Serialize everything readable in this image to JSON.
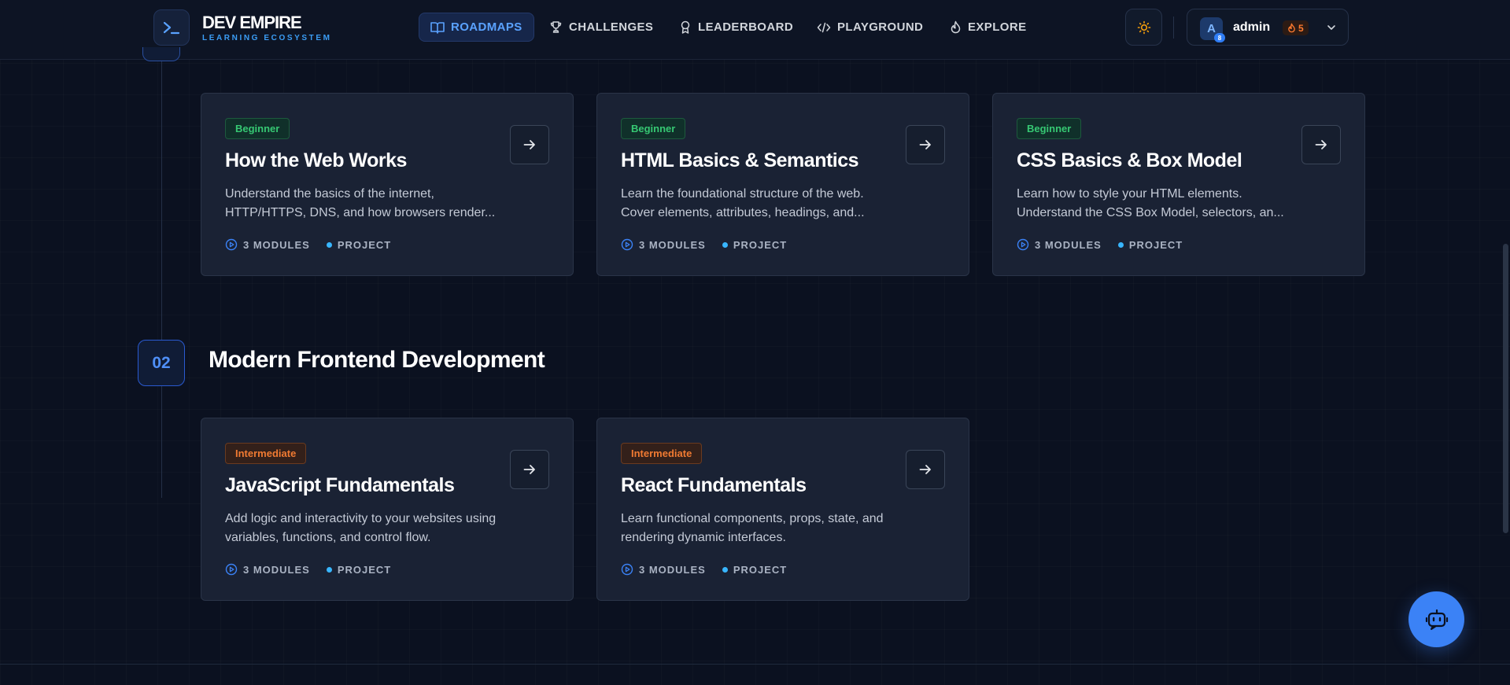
{
  "brand": {
    "title": "DEV EMPIRE",
    "subtitle": "LEARNING ECOSYSTEM",
    "accent": "#3b82f6"
  },
  "nav": [
    {
      "label": "ROADMAPS",
      "icon": "book-open-icon",
      "active": true
    },
    {
      "label": "CHALLENGES",
      "icon": "trophy-icon",
      "active": false
    },
    {
      "label": "LEADERBOARD",
      "icon": "award-icon",
      "active": false
    },
    {
      "label": "PLAYGROUND",
      "icon": "code-icon",
      "active": false
    },
    {
      "label": "EXPLORE",
      "icon": "flame-icon",
      "active": false
    }
  ],
  "user": {
    "avatar_initial": "A",
    "avatar_badge": "8",
    "name": "admin",
    "streak": "5"
  },
  "sections": [
    {
      "number": "02",
      "title": "Modern Frontend Development"
    }
  ],
  "cards": [
    {
      "level": "Beginner",
      "title": "How the Web Works",
      "description": "Understand the basics of the internet, HTTP/HTTPS, DNS, and how browsers render...",
      "modules": "3 MODULES",
      "project": "PROJECT"
    },
    {
      "level": "Beginner",
      "title": "HTML Basics & Semantics",
      "description": "Learn the foundational structure of the web. Cover elements, attributes, headings, and...",
      "modules": "3 MODULES",
      "project": "PROJECT"
    },
    {
      "level": "Beginner",
      "title": "CSS Basics & Box Model",
      "description": "Learn how to style your HTML elements. Understand the CSS Box Model, selectors, an...",
      "modules": "3 MODULES",
      "project": "PROJECT"
    },
    {
      "level": "Intermediate",
      "title": "JavaScript Fundamentals",
      "description": "Add logic and interactivity to your websites using variables, functions, and control flow.",
      "modules": "3 MODULES",
      "project": "PROJECT"
    },
    {
      "level": "Intermediate",
      "title": "React Fundamentals",
      "description": "Learn functional components, props, state, and rendering dynamic interfaces.",
      "modules": "3 MODULES",
      "project": "PROJECT"
    }
  ],
  "colors": {
    "beginner": "#36c873",
    "intermediate": "#f07a32",
    "project_dot": "#38b6ff"
  }
}
